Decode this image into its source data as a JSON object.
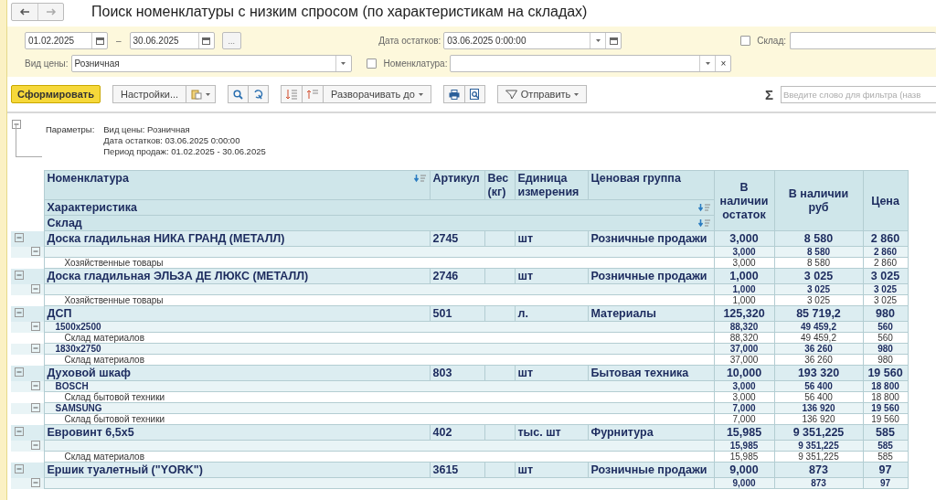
{
  "window": {
    "title": "Поиск номенклатуры с низким спросом (по характеристикам на складах)"
  },
  "filters": {
    "period_start": "01.02.2025",
    "period_separator": "–",
    "period_end": "30.06.2025",
    "period_button": "...",
    "balance_date": {
      "label": "Дата остатков:",
      "value": "03.06.2025  0:00:00"
    },
    "warehouse": {
      "label": "Склад:",
      "checked": false
    },
    "price_type": {
      "label": "Вид цены:",
      "value": "Розничная"
    },
    "nomenclature": {
      "label": "Номенклатура:",
      "checked": false,
      "clear": "×"
    }
  },
  "toolbar": {
    "generate": "Сформировать",
    "settings": "Настройки...",
    "expand_to": "Разворачивать до",
    "send": "Отправить",
    "sum_sign": "Σ",
    "filter_placeholder": "Введите слово для фильтра (назв"
  },
  "report": {
    "expanded": true,
    "parameters_label": "Параметры:",
    "parameters": [
      "Вид цены: Розничная",
      "Дата остатков: 03.06.2025 0:00:00",
      "Период продаж: 01.02.2025 - 30.06.2025"
    ],
    "columns": [
      "Номенклатура",
      "Артикул",
      "Вес (кг)",
      "Единица измерения",
      "Ценовая группа",
      "В наличии остаток",
      "В наличии руб",
      "Цена"
    ],
    "sub_headers": [
      "Характеристика",
      "Склад"
    ],
    "products": [
      {
        "name": "Доска гладильная  НИКА ГРАНД (МЕТАЛЛ)",
        "article": "2745",
        "unit": "шт",
        "price_group": "Розничные продажи",
        "qty": "3,000",
        "sum": "8 580",
        "price": "2 860",
        "expanded": true,
        "characteristics": [
          {
            "qty": "3,000",
            "sum": "8 580",
            "price": "2 860",
            "expanded": true,
            "warehouses": [
              {
                "name": "Хозяйственные товары",
                "qty": "3,000",
                "sum": "8 580",
                "price": "2 860"
              }
            ]
          }
        ]
      },
      {
        "name": "Доска гладильная  ЭЛЬЗА ДЕ ЛЮКС (МЕТАЛЛ)",
        "article": "2746",
        "unit": "шт",
        "price_group": "Розничные продажи",
        "qty": "1,000",
        "sum": "3 025",
        "price": "3 025",
        "expanded": true,
        "characteristics": [
          {
            "qty": "1,000",
            "sum": "3 025",
            "price": "3 025",
            "expanded": true,
            "warehouses": [
              {
                "name": "Хозяйственные товары",
                "qty": "1,000",
                "sum": "3 025",
                "price": "3 025"
              }
            ]
          }
        ]
      },
      {
        "name": "ДСП",
        "article": "501",
        "unit": "л.",
        "price_group": "Материалы",
        "qty": "125,320",
        "sum": "85 719,2",
        "price": "980",
        "expanded": true,
        "characteristics": [
          {
            "name": "1500x2500",
            "qty": "88,320",
            "sum": "49 459,2",
            "price": "560",
            "expanded": true,
            "warehouses": [
              {
                "name": "Склад материалов",
                "qty": "88,320",
                "sum": "49 459,2",
                "price": "560"
              }
            ]
          },
          {
            "name": "1830x2750",
            "qty": "37,000",
            "sum": "36 260",
            "price": "980",
            "expanded": true,
            "warehouses": [
              {
                "name": "Склад материалов",
                "qty": "37,000",
                "sum": "36 260",
                "price": "980"
              }
            ]
          }
        ]
      },
      {
        "name": "Духовой шкаф",
        "article": "803",
        "unit": "шт",
        "price_group": "Бытовая техника",
        "qty": "10,000",
        "sum": "193 320",
        "price": "19 560",
        "expanded": true,
        "characteristics": [
          {
            "name": "BOSCH",
            "qty": "3,000",
            "sum": "56 400",
            "price": "18 800",
            "expanded": true,
            "warehouses": [
              {
                "name": "Склад бытовой техники",
                "qty": "3,000",
                "sum": "56 400",
                "price": "18 800"
              }
            ]
          },
          {
            "name": "SAMSUNG",
            "qty": "7,000",
            "sum": "136 920",
            "price": "19 560",
            "expanded": true,
            "warehouses": [
              {
                "name": "Склад бытовой техники",
                "qty": "7,000",
                "sum": "136 920",
                "price": "19 560"
              }
            ]
          }
        ]
      },
      {
        "name": "Евровинт 6,5x5",
        "article": "402",
        "unit": "тыс. шт",
        "price_group": "Фурнитура",
        "qty": "15,985",
        "sum": "9 351,225",
        "price": "585",
        "expanded": true,
        "characteristics": [
          {
            "qty": "15,985",
            "sum": "9 351,225",
            "price": "585",
            "expanded": true,
            "warehouses": [
              {
                "name": "Склад материалов",
                "qty": "15,985",
                "sum": "9 351,225",
                "price": "585"
              }
            ]
          }
        ]
      },
      {
        "name": "Ершик туалетный (\"YORK\")",
        "article": "3615",
        "unit": "шт",
        "price_group": "Розничные продажи",
        "qty": "9,000",
        "sum": "873",
        "price": "97",
        "expanded": true,
        "characteristics": [
          {
            "qty": "9,000",
            "sum": "873",
            "price": "97",
            "expanded": true
          }
        ]
      }
    ]
  }
}
